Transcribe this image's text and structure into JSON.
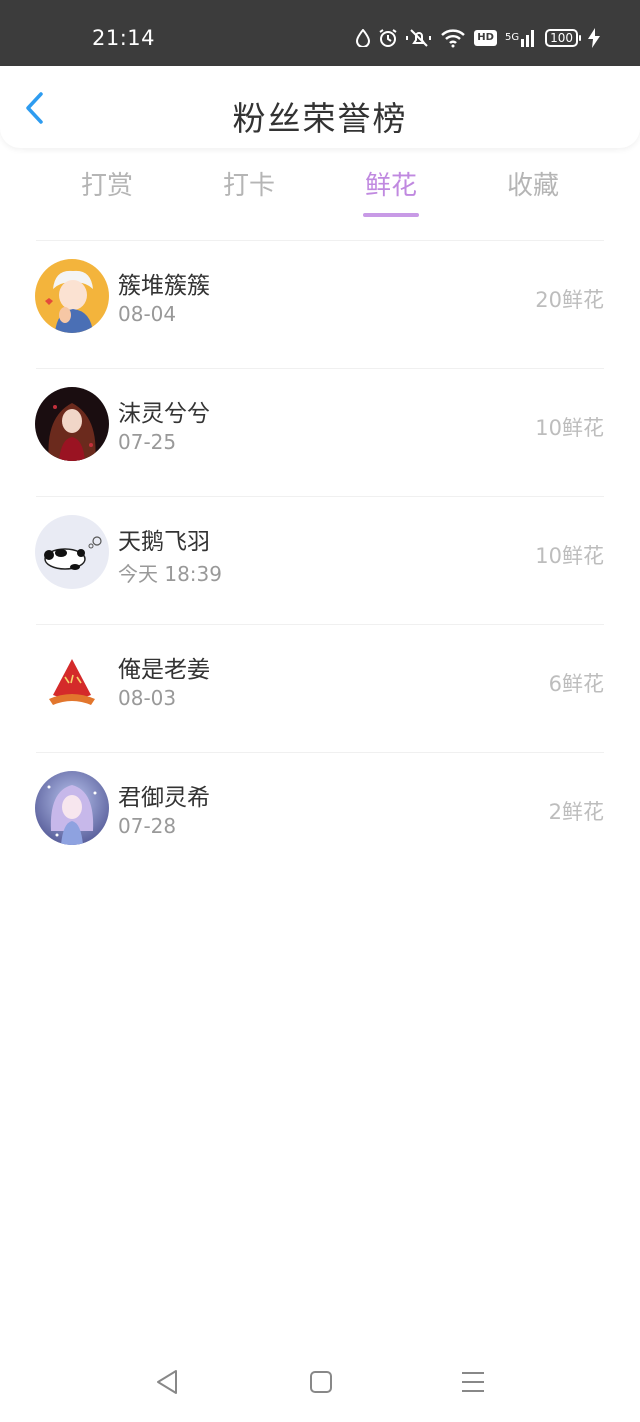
{
  "status_bar": {
    "time": "21:14",
    "icons": [
      "drop-icon",
      "alarm-icon",
      "mute-icon",
      "wifi-icon",
      "hd-icon",
      "signal-icon",
      "battery-icon",
      "charging-icon"
    ],
    "hd": "HD",
    "network": "5G",
    "battery": "100"
  },
  "header": {
    "title": "粉丝荣誉榜",
    "back_icon": "chevron-left-icon",
    "accent": "#2e9cf0"
  },
  "tabs": [
    {
      "label": "打赏",
      "active": false
    },
    {
      "label": "打卡",
      "active": false
    },
    {
      "label": "鲜花",
      "active": true
    },
    {
      "label": "收藏",
      "active": false
    }
  ],
  "active_color": "#c089e0",
  "fans": [
    {
      "name": "簇堆簇簇",
      "date": "08-04",
      "amount": "20鲜花"
    },
    {
      "name": "沫灵兮兮",
      "date": "07-25",
      "amount": "10鲜花"
    },
    {
      "name": "天鹅飞羽",
      "date": "今天 18:39",
      "amount": "10鲜花"
    },
    {
      "name": "俺是老姜",
      "date": "08-03",
      "amount": "6鲜花"
    },
    {
      "name": "君御灵希",
      "date": "07-28",
      "amount": "2鲜花"
    }
  ],
  "system_nav": {
    "icons": [
      "back-triangle-icon",
      "home-square-icon",
      "menu-lines-icon"
    ]
  }
}
